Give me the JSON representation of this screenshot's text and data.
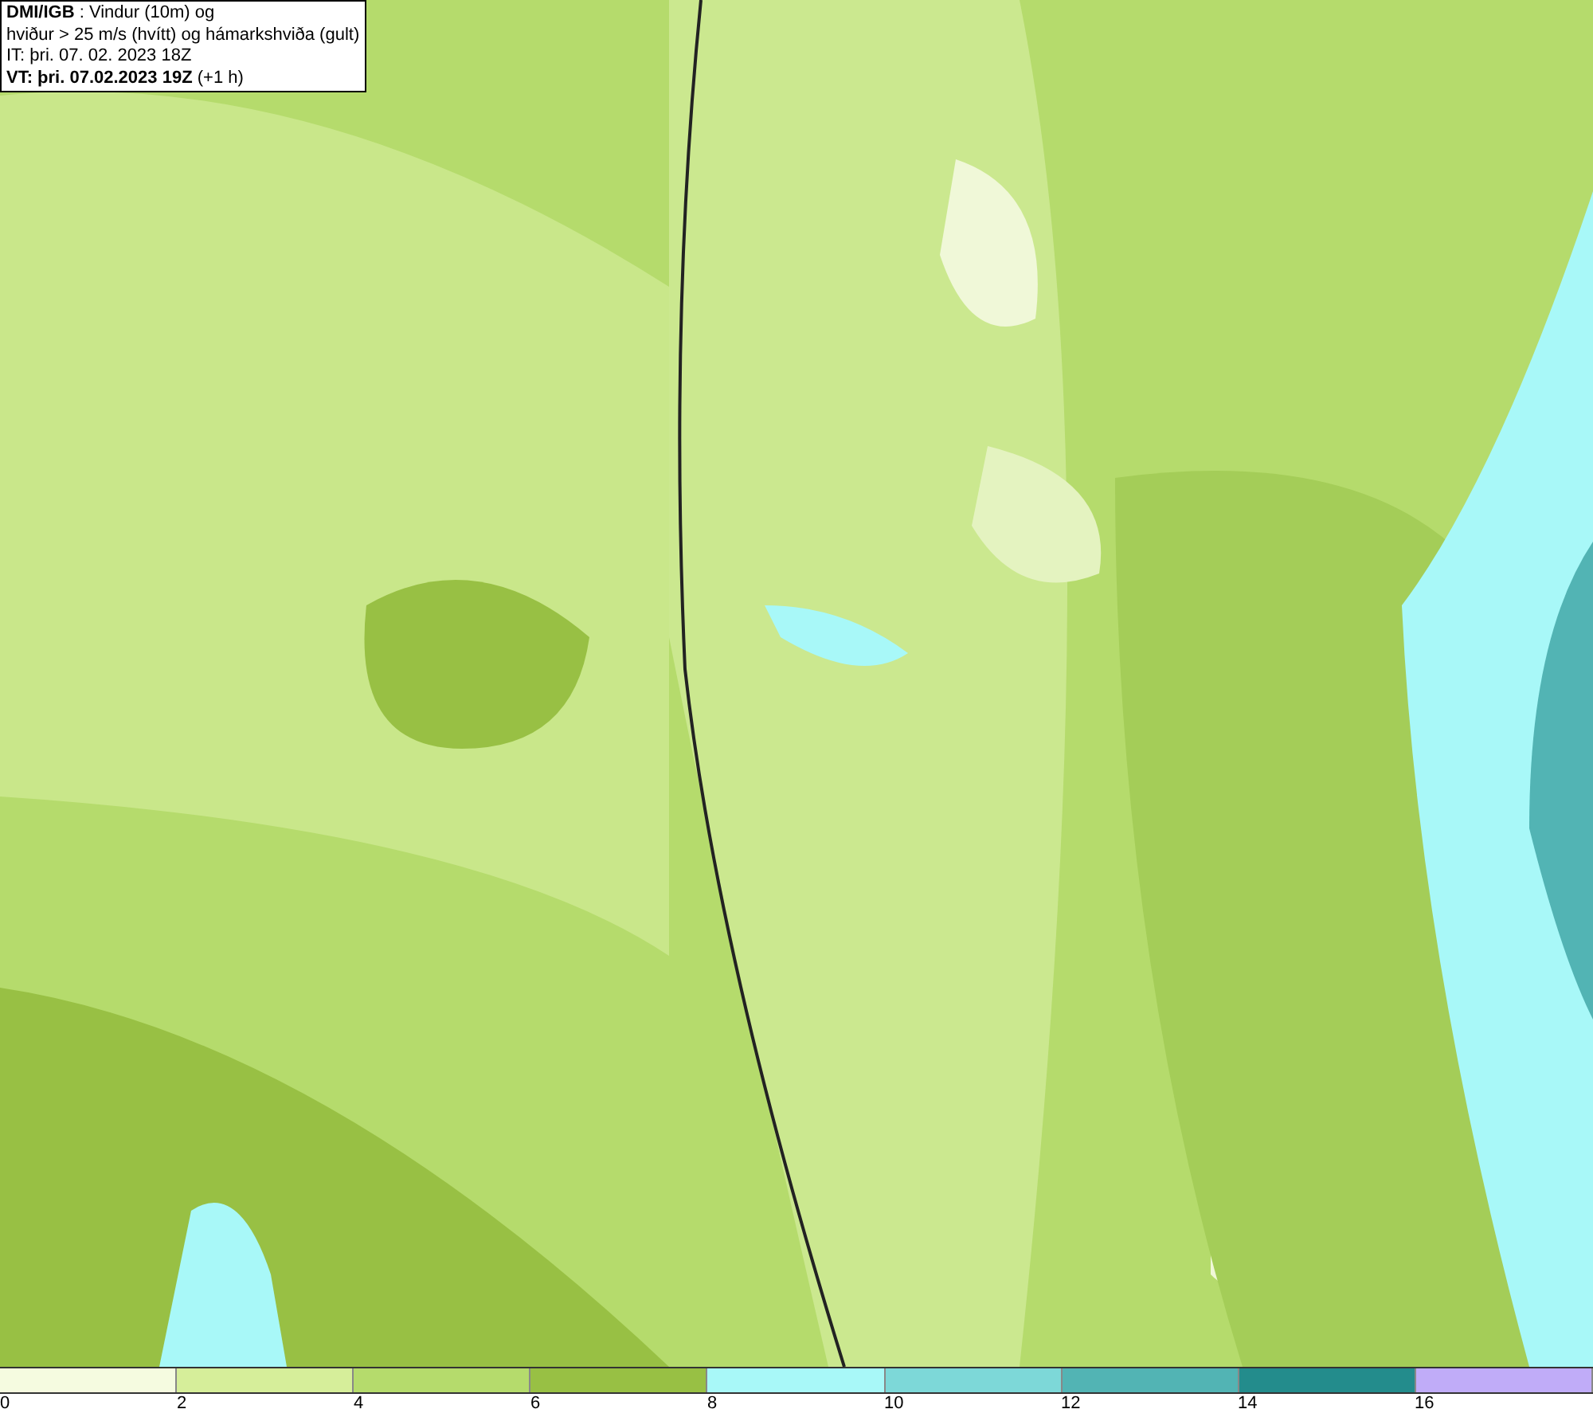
{
  "header": {
    "lines": [
      "**DMI/IGB** : Vindur (10m) og",
      "hviður > 25 m/s (hvítt) og hámarkshviða (gult)",
      "IT: þri. 07. 02. 2023 18Z",
      "**VT: þri. 07.02.2023 19Z** (+1 h)"
    ]
  },
  "legend": {
    "segments": [
      {
        "label": "0",
        "color": "#f5fbe0"
      },
      {
        "label": "2",
        "color": "#d6ee9a"
      },
      {
        "label": "4",
        "color": "#b5db6c"
      },
      {
        "label": "6",
        "color": "#98c044"
      },
      {
        "label": "8",
        "color": "#a8f8f8"
      },
      {
        "label": "10",
        "color": "#7dd8d8"
      },
      {
        "label": "12",
        "color": "#52b4b4"
      },
      {
        "label": "14",
        "color": "#238c8c"
      },
      {
        "label": "16",
        "color": "#c0acf8"
      }
    ]
  }
}
